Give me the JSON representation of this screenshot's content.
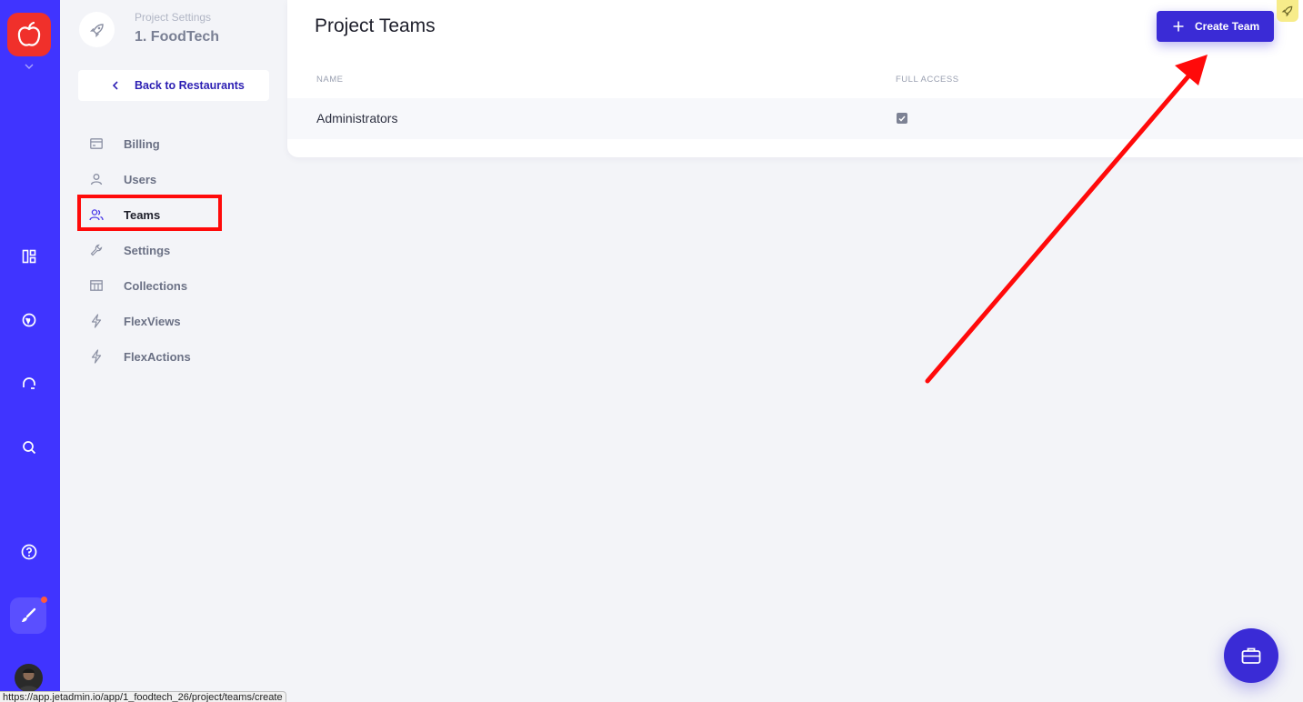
{
  "project": {
    "section_label": "Project Settings",
    "name": "1. FoodTech",
    "back_label": "Back to Restaurants"
  },
  "nav": {
    "items": [
      {
        "label": "Billing",
        "icon": "billing-icon"
      },
      {
        "label": "Users",
        "icon": "user-icon"
      },
      {
        "label": "Teams",
        "icon": "teams-icon",
        "active": true
      },
      {
        "label": "Settings",
        "icon": "wrench-icon"
      },
      {
        "label": "Collections",
        "icon": "table-icon"
      },
      {
        "label": "FlexViews",
        "icon": "bolt-icon"
      },
      {
        "label": "FlexActions",
        "icon": "bolt-icon"
      }
    ]
  },
  "main": {
    "title": "Project Teams",
    "create_button": "Create Team",
    "columns": [
      "NAME",
      "FULL ACCESS"
    ],
    "rows": [
      {
        "name": "Administrators",
        "full_access": true
      }
    ]
  },
  "status_bar": {
    "url": "https://app.jetadmin.io/app/1_foodtech_26/project/teams/create"
  },
  "colors": {
    "rail": "#4034ff",
    "primary": "#3a2bd6",
    "logo": "#f0302b",
    "annotation": "#ff0a0a"
  }
}
